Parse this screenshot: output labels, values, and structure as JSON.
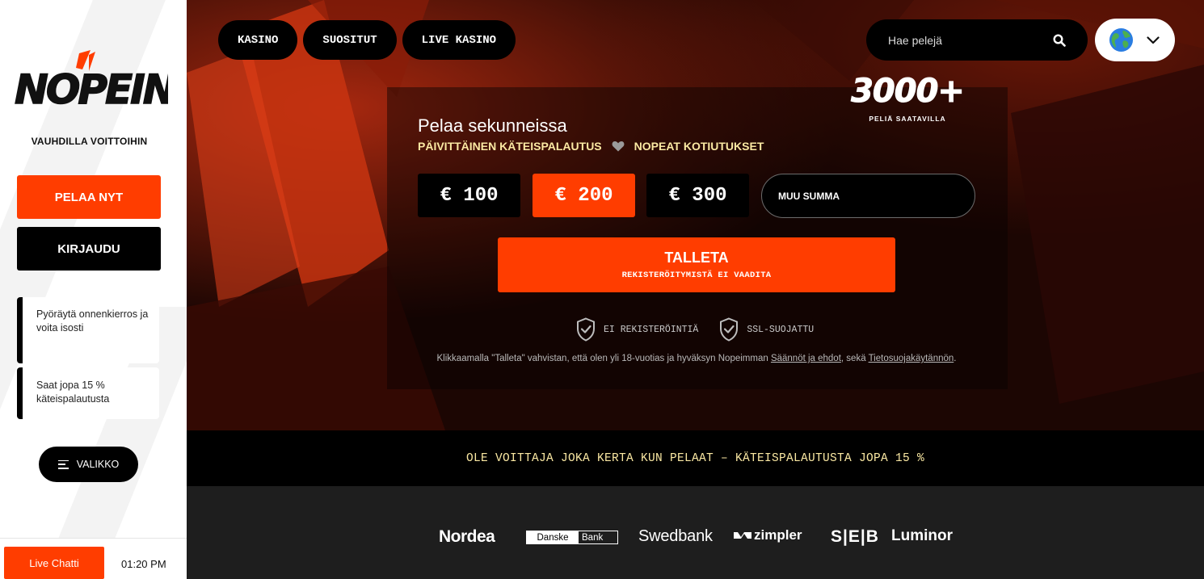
{
  "sidebar": {
    "logo_text": "NOPEIN",
    "tagline": "VAUHDILLA VOITTOIHIN",
    "play_button": "PELAA NYT",
    "login_button": "KIRJAUDU",
    "promos": [
      {
        "text": "Pyöräytä onnenkierros ja voita isosti"
      },
      {
        "text": "Saat jopa 15 % käteispalautusta"
      }
    ],
    "menu_button": "VALIKKO",
    "chat_button": "Live Chatti",
    "clock": "01:20 PM"
  },
  "nav": {
    "tabs": [
      {
        "label": "KASINO"
      },
      {
        "label": "SUOSITUT"
      },
      {
        "label": "LIVE KASINO"
      }
    ],
    "search_placeholder": "Hae pelejä"
  },
  "hero": {
    "games_count": "3000+",
    "games_label": "PELIÄ SAATAVILLA",
    "headline": "Pelaa sekunneissa",
    "feature_1": "PÄIVITTÄINEN KÄTEISPALAUTUS",
    "feature_2": "NOPEAT KOTIUTUKSET",
    "amounts": [
      "€ 100",
      "€ 200",
      "€ 300"
    ],
    "selected_amount_index": 1,
    "custom_amount": "MUU SUMMA",
    "deposit_label": "TALLETA",
    "deposit_sublabel": "REKISTERÖITYMISTÄ EI VAADITA",
    "trust_1": "EI REKISTERÖINTIÄ",
    "trust_2": "SSL-SUOJATTU",
    "disclaimer_pre": "Klikkaamalla \"Talleta\" vahvistan, että olen yli 18-vuotias ja hyväksyn Nopeimman ",
    "disclaimer_link_1": "Säännöt ja ehdot",
    "disclaimer_mid": ", sekä ",
    "disclaimer_link_2": "Tietosuojakäytännön",
    "disclaimer_post": "."
  },
  "banner": {
    "text": "OLE VOITTAJA JOKA KERTA KUN PELAAT – KÄTEISPALAUTUSTA JOPA 15 %"
  },
  "payments": {
    "nordea": "Nordea",
    "danske_1": "Danske",
    "danske_2": "Bank",
    "swedbank": "Swedbank",
    "zimpler": "zimpler",
    "seb": "S|E|B",
    "luminor": "Luminor"
  },
  "colors": {
    "accent": "#ff3d00",
    "highlight_text": "#fbe9a3",
    "dark": "#000000"
  }
}
